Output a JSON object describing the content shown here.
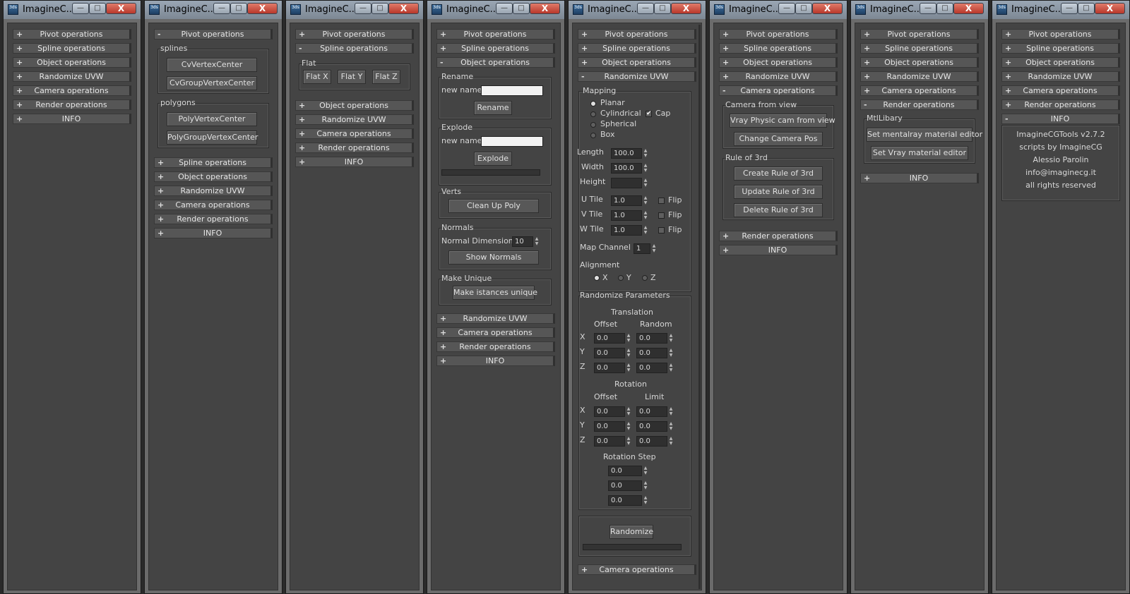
{
  "window_title": "ImagineC...",
  "app_icon": "3ds",
  "titlebar_buttons": {
    "minimize": "—",
    "maximize": "□",
    "close": "X"
  },
  "rollouts": {
    "pivot": "Pivot operations",
    "spline": "Spline operations",
    "object": "Object operations",
    "uvw": "Randomize UVW",
    "camera": "Camera operations",
    "render": "Render operations",
    "info": "INFO"
  },
  "collapsed_sign": "+",
  "expanded_sign": "-",
  "pivot_panel": {
    "splines_label": "splines",
    "cv_vertex_center": "CvVertexCenter",
    "cv_group_vertex_center": "CvGroupVertexCenter",
    "polygons_label": "polygons",
    "poly_vertex_center": "PolyVertexCenter",
    "poly_group_vertex_center": "PolyGroupVertexCenter"
  },
  "spline_panel": {
    "flat_label": "Flat",
    "flat_x": "Flat X",
    "flat_y": "Flat Y",
    "flat_z": "Flat Z"
  },
  "object_panel": {
    "rename_label": "Rename",
    "new_name_label": "new name",
    "rename_input": "",
    "rename_button": "Rename",
    "explode_label": "Explode",
    "explode_input": "",
    "explode_button": "Explode",
    "verts_label": "Verts",
    "clean_up_poly": "Clean Up Poly",
    "normals_label": "Normals",
    "normal_dimension_label": "Normal Dimension",
    "normal_dimension_value": "10",
    "show_normals": "Show Normals",
    "make_unique_label": "Make Unique",
    "make_unique_button": "Make istances unique"
  },
  "uvw_panel": {
    "mapping_label": "Mapping",
    "planar": "Planar",
    "cylindrical": "Cylindrical",
    "cap": "Cap",
    "cap_checked": "✔",
    "spherical": "Spherical",
    "box": "Box",
    "length_label": "Length",
    "length_value": "100.0",
    "width_label": "Width",
    "width_value": "100.0",
    "height_label": "Height",
    "height_value": "",
    "u_tile_label": "U Tile",
    "u_tile_value": "1.0",
    "v_tile_label": "V Tile",
    "v_tile_value": "1.0",
    "w_tile_label": "W Tile",
    "w_tile_value": "1.0",
    "flip_label": "Flip",
    "map_channel_label": "Map Channel",
    "map_channel_value": "1",
    "alignment_label": "Alignment",
    "align_x": "X",
    "align_y": "Y",
    "align_z": "Z",
    "randomize_parameters_label": "Randomize Parameters",
    "translation_label": "Translation",
    "offset_label": "Offset",
    "random_label": "Random",
    "limit_label": "Limit",
    "rotation_label": "Rotation",
    "axis_x": "X",
    "axis_y": "Y",
    "axis_z": "Z",
    "zero": "0.0",
    "rotation_step_label": "Rotation Step",
    "randomize_button": "Randomize"
  },
  "camera_panel": {
    "camera_from_view_label": "Camera from view",
    "vray_physic_cam": "Vray Physic cam from view",
    "change_camera_pos": "Change Camera Pos",
    "rule_of_3rd_label": "Rule of 3rd",
    "create_rule": "Create Rule of 3rd",
    "update_rule": "Update Rule of 3rd",
    "delete_rule": "Delete Rule of 3rd"
  },
  "render_panel": {
    "mtl_library_label": "MtlLibary",
    "set_mentalray": "Set mentalray material editor",
    "set_vray": "Set Vray material editor"
  },
  "info_panel": {
    "version": "ImagineCGTools v2.7.2",
    "scripts_by": "scripts by ImagineCG",
    "author": "Alessio Parolin",
    "email": "info@imaginecg.it",
    "rights": "all rights reserved"
  }
}
